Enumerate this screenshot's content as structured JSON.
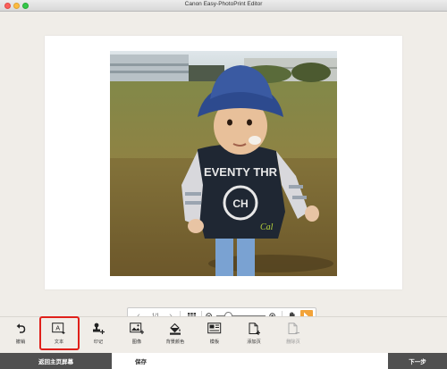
{
  "window": {
    "title": "Canon Easy-PhotoPrint Editor"
  },
  "zoombar": {
    "prev_label": "‹",
    "page_indicator": "1/1",
    "next_label": "›",
    "zoom_level": 0.25
  },
  "tools": [
    {
      "name": "undo",
      "label": "撤销",
      "icon": "undo-icon"
    },
    {
      "name": "text",
      "label": "文本",
      "icon": "text-box-icon"
    },
    {
      "name": "stamp",
      "label": "印记",
      "icon": "stamp-icon"
    },
    {
      "name": "image",
      "label": "图像",
      "icon": "image-add-icon"
    },
    {
      "name": "bgcolor",
      "label": "背景颜色",
      "icon": "paint-bucket-icon"
    },
    {
      "name": "template",
      "label": "模板",
      "icon": "template-icon"
    },
    {
      "name": "add-page",
      "label": "添加页",
      "icon": "add-page-icon"
    },
    {
      "name": "delete-page",
      "label": "删除页",
      "icon": "delete-page-icon"
    }
  ],
  "footer": {
    "home_label": "返回主页屏幕",
    "save_label": "保存",
    "next_label": "下一步"
  },
  "colors": {
    "accent": "#f2a33a",
    "footer_dark": "#505050",
    "highlight": "#e0201a"
  }
}
